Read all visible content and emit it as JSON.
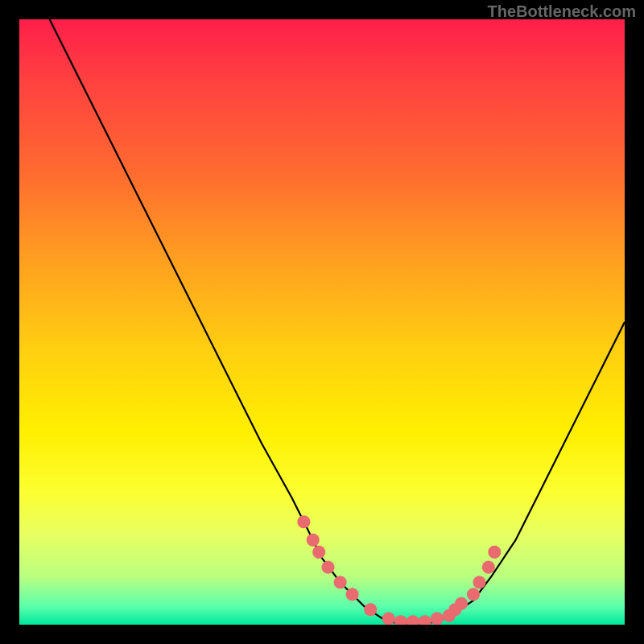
{
  "watermark": "TheBottleneck.com",
  "chart_data": {
    "type": "line",
    "title": "",
    "xlabel": "",
    "ylabel": "",
    "xlim": [
      0,
      100
    ],
    "ylim": [
      0,
      100
    ],
    "series": [
      {
        "name": "curve",
        "x": [
          5,
          10,
          15,
          20,
          25,
          30,
          35,
          40,
          45,
          48,
          50,
          53,
          57,
          60,
          63,
          67,
          70,
          72,
          75,
          78,
          82,
          86,
          90,
          95,
          100
        ],
        "y": [
          100,
          90,
          80,
          70,
          60,
          50,
          40,
          30,
          21,
          15,
          11,
          7,
          3,
          1,
          0,
          0,
          1,
          2,
          4,
          8,
          14,
          22,
          30,
          40,
          50
        ]
      }
    ],
    "markers": {
      "name": "points",
      "x": [
        47,
        48.5,
        49.5,
        51,
        53,
        55,
        58,
        61,
        63,
        65,
        67,
        69,
        71,
        72,
        73,
        75,
        76,
        77.5,
        78.5
      ],
      "y": [
        17,
        14,
        12,
        9.5,
        7,
        5,
        2.5,
        1,
        0.5,
        0.5,
        0.5,
        1,
        1.5,
        2.5,
        3.5,
        5,
        7,
        9.5,
        12
      ]
    },
    "gradient_stops": [
      {
        "pos": 0,
        "color": "#ff1e4b"
      },
      {
        "pos": 25,
        "color": "#ff6a30"
      },
      {
        "pos": 55,
        "color": "#ffd010"
      },
      {
        "pos": 78,
        "color": "#fcff30"
      },
      {
        "pos": 100,
        "color": "#00e89c"
      }
    ]
  }
}
